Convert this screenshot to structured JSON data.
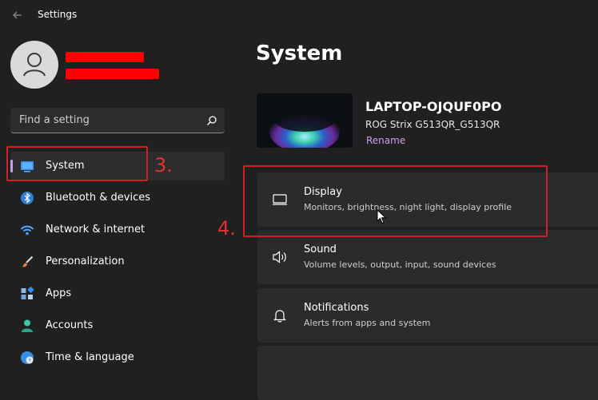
{
  "window": {
    "title": "Settings",
    "back_icon": "back-arrow-icon"
  },
  "account": {
    "avatar_icon": "person-icon",
    "name_redacted": true
  },
  "search": {
    "placeholder": "Find a setting",
    "value": "",
    "icon": "search-icon"
  },
  "sidebar": {
    "items": [
      {
        "label": "System",
        "icon": "system-monitor-icon",
        "active": true
      },
      {
        "label": "Bluetooth & devices",
        "icon": "bluetooth-icon",
        "active": false
      },
      {
        "label": "Network & internet",
        "icon": "wifi-icon",
        "active": false
      },
      {
        "label": "Personalization",
        "icon": "paintbrush-icon",
        "active": false
      },
      {
        "label": "Apps",
        "icon": "apps-icon",
        "active": false
      },
      {
        "label": "Accounts",
        "icon": "accounts-icon",
        "active": false
      },
      {
        "label": "Time & language",
        "icon": "globe-clock-icon",
        "active": false
      }
    ]
  },
  "annotations": {
    "step3": "3.",
    "step4": "4.",
    "color": "#e13232"
  },
  "main": {
    "title": "System",
    "device": {
      "name": "LAPTOP-OJQUF0PO",
      "model": "ROG Strix G513QR_G513QR",
      "rename_label": "Rename"
    },
    "cards": [
      {
        "title": "Display",
        "subtitle": "Monitors, brightness, night light, display profile",
        "icon": "display-icon"
      },
      {
        "title": "Sound",
        "subtitle": "Volume levels, output, input, sound devices",
        "icon": "speaker-icon"
      },
      {
        "title": "Notifications",
        "subtitle": "Alerts from apps and system",
        "icon": "bell-icon"
      },
      {
        "title": "",
        "subtitle": "",
        "icon": ""
      }
    ]
  },
  "colors": {
    "background": "#202020",
    "card": "#2b2b2b",
    "accent": "#c9a0e8",
    "annotation_red": "#d42020"
  }
}
